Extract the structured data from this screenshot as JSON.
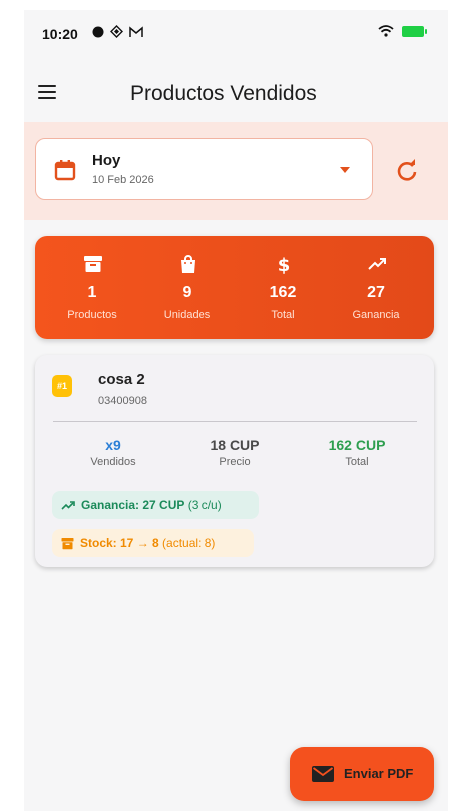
{
  "status_bar": {
    "time": "10:20",
    "icons": [
      "circle-icon",
      "diamond-icon",
      "gmail-icon"
    ],
    "right_icons": [
      "wifi-icon",
      "battery-charging-icon"
    ]
  },
  "app_bar": {
    "title": "Productos Vendidos",
    "menu_icon": "menu-icon"
  },
  "date_filter": {
    "label": "Hoy",
    "date": "10 Feb 2026",
    "icon": "calendar-icon",
    "refresh_icon": "refresh-icon"
  },
  "summary": {
    "stats": [
      {
        "icon": "archive-icon",
        "value": "1",
        "label": "Productos"
      },
      {
        "icon": "shopping-bag-icon",
        "value": "9",
        "label": "Unidades"
      },
      {
        "icon": "dollar-icon",
        "value": "162",
        "label": "Total"
      },
      {
        "icon": "trending-up-icon",
        "value": "27",
        "label": "Ganancia"
      }
    ]
  },
  "products": [
    {
      "rank": "#1",
      "name": "cosa 2",
      "code": "03400908",
      "metrics": [
        {
          "value": "x9",
          "label": "Vendidos",
          "color": "#2b7fd6"
        },
        {
          "value": "18 CUP",
          "label": "Precio",
          "color": "#4a4a4a"
        },
        {
          "value": "162 CUP",
          "label": "Total",
          "color": "#2e9e4f"
        }
      ],
      "gain_bold": "Ganancia: 27 CUP",
      "gain_light": "(3 c/u)",
      "stock_bold": "Stock: 17 → 8",
      "stock_light": "(actual: 8)"
    }
  ],
  "fab": {
    "label": "Enviar PDF",
    "icon": "mail-icon"
  },
  "colors": {
    "accent": "#f4511e",
    "filter_band": "#fbe7e1",
    "gain_green": "#1b8a5a",
    "stock_orange": "#f08a00",
    "badge_yellow": "#ffc107"
  }
}
